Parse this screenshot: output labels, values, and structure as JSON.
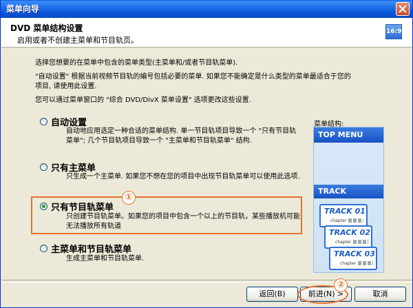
{
  "window": {
    "title": "菜单向导",
    "close_icon": "close-icon"
  },
  "header": {
    "title": "DVD 菜单结构设置",
    "subtitle": "启用或者不创建主菜单和节目轨页。",
    "ratio_badge": "16:9"
  },
  "intro": {
    "line1": "选择您想要的在菜单中包含的菜单类型(主菜单和/或者节目轨菜单).",
    "line2a": "\"自动设置\" 根据当前视频节目轨的编号包括必要的菜单. 如果您不能确定是什么类型的菜单最适合于您的",
    "line2b": "项目, 请使用此设置.",
    "line3": "您可以通过菜单窗口的 \"综合 DVD/DivX 菜单设置\" 选项更改这些设置."
  },
  "options": [
    {
      "label": "自动设置",
      "desc": "自动地应用选定一种合适的菜单结构. 单一节目轨项目导致一个 \"只有节目轨菜单\"; 几个节目轨项目导致一个 \"主菜单和节目轨菜单\" 结构.",
      "checked": false
    },
    {
      "label": "只有主菜单",
      "desc": "只生成一个主菜单. 如果您不想在您的项目中出现节目轨菜单可以使用此选项.",
      "checked": false
    },
    {
      "label": "只有节目轨菜单",
      "desc": "只创建节目轨菜单。如果您的项目中包含一个以上的节目轨，某些播放机可能无法播放所有轨道",
      "checked": true
    },
    {
      "label": "主菜单和节目轨菜单",
      "desc": "生成主菜单和节目轨菜单.",
      "checked": false
    }
  ],
  "structure": {
    "label": "菜单结构:",
    "top_menu": "TOP MENU",
    "track": "TRACK",
    "cards": [
      {
        "name": "TRACK 01",
        "chapter": "chapter"
      },
      {
        "name": "TRACK 02",
        "chapter": "chapter"
      },
      {
        "name": "TRACK 03",
        "chapter": "chapter"
      }
    ]
  },
  "markers": {
    "one": "①",
    "two": "②"
  },
  "buttons": {
    "back": "返回(B)",
    "next": "前进(N) >",
    "cancel": "取消"
  },
  "colors": {
    "annotation": "#e4722c",
    "selected_radio": "#21a121",
    "titlebar": "#0b56d8"
  }
}
